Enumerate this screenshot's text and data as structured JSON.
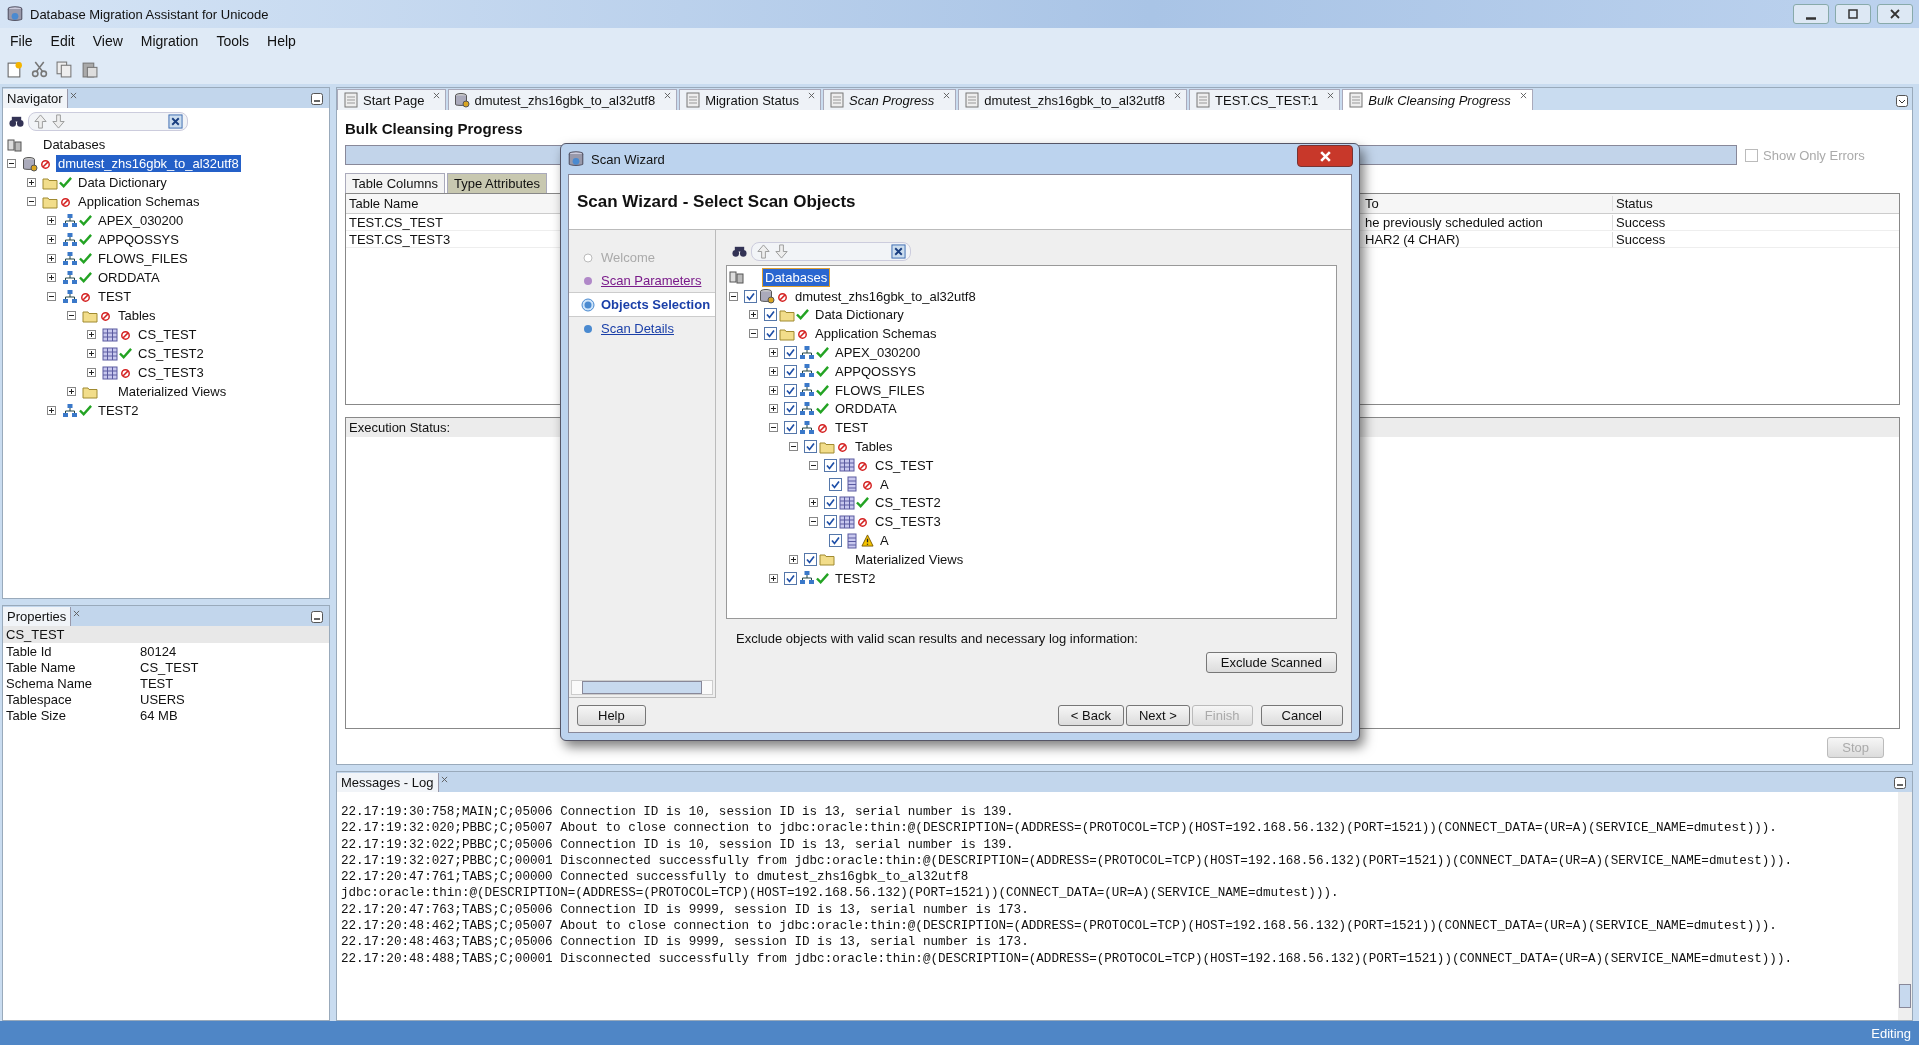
{
  "window": {
    "title": "Database Migration Assistant for Unicode"
  },
  "menu": [
    "File",
    "Edit",
    "View",
    "Migration",
    "Tools",
    "Help"
  ],
  "navigator": {
    "title": "Navigator",
    "tree": [
      {
        "label": "Databases",
        "kind": "root",
        "selected": false,
        "children": [
          {
            "label": "dmutest_zhs16gbk_to_al32utf8",
            "kind": "database",
            "status": {
              "kind": "error"
            },
            "expanded": true,
            "selected": true,
            "children": [
              {
                "label": "Data Dictionary",
                "kind": "folder",
                "status": {
                  "kind": "ok"
                },
                "expanded": false,
                "selected": false
              },
              {
                "label": "Application Schemas",
                "kind": "folder",
                "status": {
                  "kind": "error"
                },
                "expanded": true,
                "selected": false,
                "children": [
                  {
                    "label": "APEX_030200",
                    "kind": "schema",
                    "status": {
                      "kind": "ok"
                    },
                    "expanded": false,
                    "selected": false
                  },
                  {
                    "label": "APPQOSSYS",
                    "kind": "schema",
                    "status": {
                      "kind": "ok"
                    },
                    "expanded": false,
                    "selected": false
                  },
                  {
                    "label": "FLOWS_FILES",
                    "kind": "schema",
                    "status": {
                      "kind": "ok"
                    },
                    "expanded": false,
                    "selected": false
                  },
                  {
                    "label": "ORDDATA",
                    "kind": "schema",
                    "status": {
                      "kind": "ok"
                    },
                    "expanded": false,
                    "selected": false
                  },
                  {
                    "label": "TEST",
                    "kind": "schema",
                    "status": {
                      "kind": "error"
                    },
                    "expanded": true,
                    "selected": false,
                    "children": [
                      {
                        "label": "Tables",
                        "kind": "folder",
                        "status": {
                          "kind": "error"
                        },
                        "expanded": true,
                        "selected": false,
                        "children": [
                          {
                            "label": "CS_TEST",
                            "kind": "table",
                            "status": {
                              "kind": "error"
                            },
                            "expanded": false,
                            "selected": false
                          },
                          {
                            "label": "CS_TEST2",
                            "kind": "table",
                            "status": {
                              "kind": "ok"
                            },
                            "expanded": false,
                            "selected": false
                          },
                          {
                            "label": "CS_TEST3",
                            "kind": "table",
                            "status": {
                              "kind": "error"
                            },
                            "expanded": false,
                            "selected": false
                          }
                        ]
                      },
                      {
                        "label": "Materialized Views",
                        "kind": "folder",
                        "expanded": false,
                        "selected": false
                      }
                    ]
                  },
                  {
                    "label": "TEST2",
                    "kind": "schema",
                    "status": {
                      "kind": "ok"
                    },
                    "expanded": false,
                    "selected": false
                  }
                ]
              }
            ]
          }
        ]
      }
    ]
  },
  "properties": {
    "title": "Properties",
    "heading": "CS_TEST",
    "rows": [
      {
        "name": "Table Id",
        "value": "80124"
      },
      {
        "name": "Table Name",
        "value": "CS_TEST"
      },
      {
        "name": "Schema Name",
        "value": "TEST"
      },
      {
        "name": "Tablespace",
        "value": "USERS"
      },
      {
        "name": "Table Size",
        "value": "64 MB"
      }
    ]
  },
  "editor_tabs": [
    {
      "label": "Start Page",
      "kind": "page",
      "italic": false,
      "selected": false
    },
    {
      "label": "dmutest_zhs16gbk_to_al32utf8",
      "kind": "database",
      "italic": false,
      "selected": false
    },
    {
      "label": "Migration Status",
      "kind": "page",
      "italic": false,
      "selected": false
    },
    {
      "label": "Scan Progress",
      "kind": "page",
      "italic": true,
      "selected": false
    },
    {
      "label": "dmutest_zhs16gbk_to_al32utf8",
      "kind": "page",
      "italic": false,
      "selected": false
    },
    {
      "label": "TEST.CS_TEST:1",
      "kind": "page",
      "italic": false,
      "selected": false
    },
    {
      "label": "Bulk Cleansing Progress",
      "kind": "page",
      "italic": true,
      "selected": true
    }
  ],
  "bulk_cleansing": {
    "title": "Bulk Cleansing Progress",
    "progress": {
      "level": 1
    },
    "show_only_errors": {
      "label": "Show Only Errors",
      "checked": false,
      "disabled": true
    },
    "tabs": [
      {
        "label": "Table Columns",
        "selected": true
      },
      {
        "label": "Type Attributes",
        "selected": false
      }
    ],
    "table": {
      "columns": [
        "Table Name",
        "To",
        "Status"
      ],
      "rows": [
        [
          "TEST.CS_TEST",
          "he previously scheduled action",
          "Success"
        ],
        [
          "TEST.CS_TEST3",
          "HAR2 (4 CHAR)",
          "Success"
        ]
      ]
    },
    "execution_status": "Execution Status:",
    "stop_button": {
      "label": "Stop",
      "disabled": true
    }
  },
  "log": {
    "title": "Messages - Log",
    "lines": [
      "22.17:19:30:758;MAIN;C;05006 Connection ID is 10, session ID is 13, serial number is 139.",
      "22.17:19:32:020;PBBC;C;05007 About to close connection to jdbc:oracle:thin:@(DESCRIPTION=(ADDRESS=(PROTOCOL=TCP)(HOST=192.168.56.132)(PORT=1521))(CONNECT_DATA=(UR=A)(SERVICE_NAME=dmutest))).",
      "22.17:19:32:022;PBBC;C;05006 Connection ID is 10, session ID is 13, serial number is 139.",
      "22.17:19:32:027;PBBC;C;00001 Disconnected successfully from jdbc:oracle:thin:@(DESCRIPTION=(ADDRESS=(PROTOCOL=TCP)(HOST=192.168.56.132)(PORT=1521))(CONNECT_DATA=(UR=A)(SERVICE_NAME=dmutest))).",
      "22.17:20:47:761;TABS;C;00000 Connected successfully to dmutest_zhs16gbk_to_al32utf8",
      "jdbc:oracle:thin:@(DESCRIPTION=(ADDRESS=(PROTOCOL=TCP)(HOST=192.168.56.132)(PORT=1521))(CONNECT_DATA=(UR=A)(SERVICE_NAME=dmutest))).",
      "22.17:20:47:763;TABS;C;05006 Connection ID is 9999, session ID is 13, serial number is 173.",
      "22.17:20:48:462;TABS;C;05007 About to close connection to jdbc:oracle:thin:@(DESCRIPTION=(ADDRESS=(PROTOCOL=TCP)(HOST=192.168.56.132)(PORT=1521))(CONNECT_DATA=(UR=A)(SERVICE_NAME=dmutest))).",
      "22.17:20:48:463;TABS;C;05006 Connection ID is 9999, session ID is 13, serial number is 173.",
      "22.17:20:48:488;TABS;C;00001 Disconnected successfully from jdbc:oracle:thin:@(DESCRIPTION=(ADDRESS=(PROTOCOL=TCP)(HOST=192.168.56.132)(PORT=1521))(CONNECT_DATA=(UR=A)(SERVICE_NAME=dmutest)))."
    ]
  },
  "status_bar": {
    "text": "Editing"
  },
  "dialog": {
    "title": "Scan Wizard",
    "heading": "Scan Wizard - Select Scan Objects",
    "steps": [
      {
        "label": "Welcome",
        "disabled": true,
        "visited": false,
        "selected": false
      },
      {
        "label": "Scan Parameters",
        "disabled": false,
        "visited": true,
        "selected": false
      },
      {
        "label": "Objects Selection",
        "disabled": false,
        "visited": false,
        "selected": true
      },
      {
        "label": "Scan Details",
        "disabled": false,
        "visited": false,
        "selected": false
      }
    ],
    "tree": [
      {
        "label": "Databases",
        "kind": "root",
        "selected": true,
        "children": [
          {
            "label": "dmutest_zhs16gbk_to_al32utf8",
            "kind": "database",
            "status": {
              "kind": "error"
            },
            "checked": true,
            "expanded": true,
            "selected": false,
            "children": [
              {
                "label": "Data Dictionary",
                "kind": "folder",
                "status": {
                  "kind": "ok"
                },
                "checked": true,
                "expanded": false,
                "selected": false
              },
              {
                "label": "Application Schemas",
                "kind": "folder",
                "status": {
                  "kind": "error"
                },
                "checked": true,
                "expanded": true,
                "selected": false,
                "children": [
                  {
                    "label": "APEX_030200",
                    "kind": "schema",
                    "status": {
                      "kind": "ok"
                    },
                    "checked": true,
                    "expanded": false,
                    "selected": false
                  },
                  {
                    "label": "APPQOSSYS",
                    "kind": "schema",
                    "status": {
                      "kind": "ok"
                    },
                    "checked": true,
                    "expanded": false,
                    "selected": false
                  },
                  {
                    "label": "FLOWS_FILES",
                    "kind": "schema",
                    "status": {
                      "kind": "ok"
                    },
                    "checked": true,
                    "expanded": false,
                    "selected": false
                  },
                  {
                    "label": "ORDDATA",
                    "kind": "schema",
                    "status": {
                      "kind": "ok"
                    },
                    "checked": true,
                    "expanded": false,
                    "selected": false
                  },
                  {
                    "label": "TEST",
                    "kind": "schema",
                    "status": {
                      "kind": "error"
                    },
                    "checked": true,
                    "expanded": true,
                    "selected": false,
                    "children": [
                      {
                        "label": "Tables",
                        "kind": "folder",
                        "status": {
                          "kind": "error"
                        },
                        "checked": true,
                        "expanded": true,
                        "selected": false,
                        "children": [
                          {
                            "label": "CS_TEST",
                            "kind": "table",
                            "status": {
                              "kind": "error"
                            },
                            "checked": true,
                            "expanded": true,
                            "selected": false,
                            "children": [
                              {
                                "label": "A",
                                "kind": "column",
                                "status": {
                                  "kind": "error"
                                },
                                "checked": true,
                                "selected": false
                              }
                            ]
                          },
                          {
                            "label": "CS_TEST2",
                            "kind": "table",
                            "status": {
                              "kind": "ok"
                            },
                            "checked": true,
                            "expanded": false,
                            "selected": false
                          },
                          {
                            "label": "CS_TEST3",
                            "kind": "table",
                            "status": {
                              "kind": "error"
                            },
                            "checked": true,
                            "expanded": true,
                            "selected": false,
                            "children": [
                              {
                                "label": "A",
                                "kind": "column",
                                "status": {
                                  "kind": "warning"
                                },
                                "checked": true,
                                "selected": false
                              }
                            ]
                          }
                        ]
                      },
                      {
                        "label": "Materialized Views",
                        "kind": "folder",
                        "checked": true,
                        "expanded": false,
                        "selected": false
                      }
                    ]
                  },
                  {
                    "label": "TEST2",
                    "kind": "schema",
                    "status": {
                      "kind": "ok"
                    },
                    "checked": true,
                    "expanded": false,
                    "selected": false
                  }
                ]
              }
            ]
          }
        ]
      }
    ],
    "exclude_text": "Exclude objects with valid scan results and necessary log information:",
    "exclude_button": "Exclude Scanned",
    "buttons": [
      {
        "label": "Help",
        "kind": "help",
        "disabled": false
      },
      {
        "label": "< Back",
        "kind": "nav",
        "disabled": false
      },
      {
        "label": "Next >",
        "kind": "nav",
        "disabled": false
      },
      {
        "label": "Finish",
        "kind": "nav",
        "disabled": true
      },
      {
        "label": "Cancel",
        "kind": "cancel",
        "disabled": false
      }
    ]
  }
}
